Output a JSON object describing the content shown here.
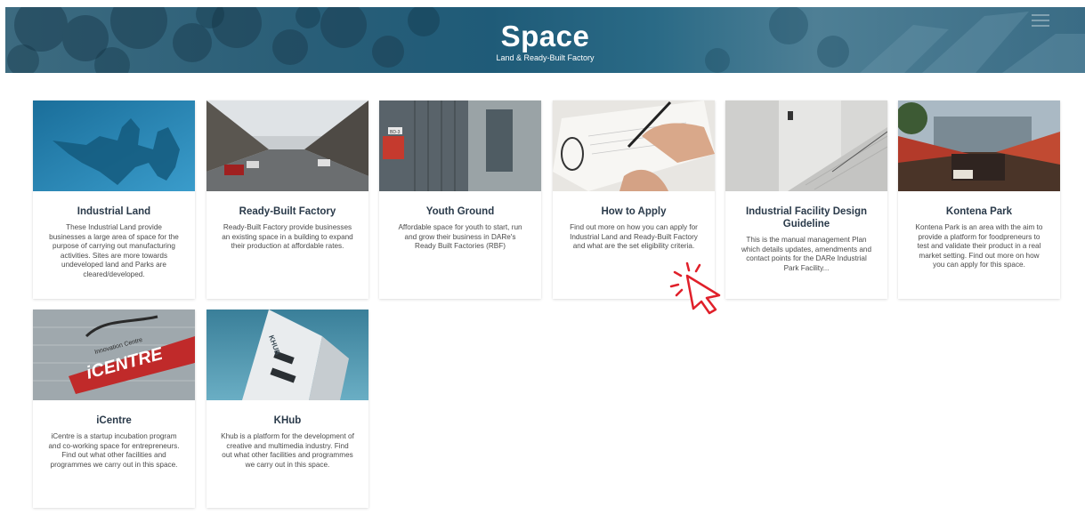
{
  "header": {
    "title": "Space",
    "subtitle": "Land & Ready-Built Factory"
  },
  "cards": [
    {
      "title": "Industrial Land",
      "description": "These Industrial Land provide businesses a large area of space for the purpose of carrying out manufacturing activities. Sites are more towards undeveloped land and Parks are cleared/developed."
    },
    {
      "title": "Ready-Built Factory",
      "description": "Ready-Built Factory provide businesses an existing space in a building to expand their production at affordable rates."
    },
    {
      "title": "Youth Ground",
      "description": "Affordable space for youth to start, run and grow their business in DARe's Ready Built Factories (RBF)"
    },
    {
      "title": "How to Apply",
      "description": "Find out more on how you can apply for Industrial Land and Ready-Built Factory and what are the set eligibility criteria."
    },
    {
      "title": "Industrial Facility Design Guideline",
      "description": "This is the manual management Plan which details updates, amendments and contact points for the DARe Industrial Park Facility..."
    },
    {
      "title": "Kontena Park",
      "description": "Kontena Park is an area with the aim to provide a platform for foodpreneurs to test and validate their product in a real market setting. Find out more on how you can apply for this space."
    },
    {
      "title": "iCentre",
      "description": "iCentre is a startup incubation program and co-working space for entrepreneurs. Find out what other facilities and programmes we carry out in this space."
    },
    {
      "title": "KHub",
      "description": "Khub is a platform for the development of creative and multimedia industry. Find out what other facilities and programmes we carry out in this space."
    }
  ],
  "images": {
    "icentre_sign": "iCENTRE",
    "icentre_sign_top": "Innovation Centre",
    "khub_sign": "KHUB",
    "youth_sign": "BD-3"
  },
  "colors": {
    "accent_red": "#e0202a",
    "title_text": "#2a3a4a",
    "banner_blue": "#2b5f78"
  }
}
